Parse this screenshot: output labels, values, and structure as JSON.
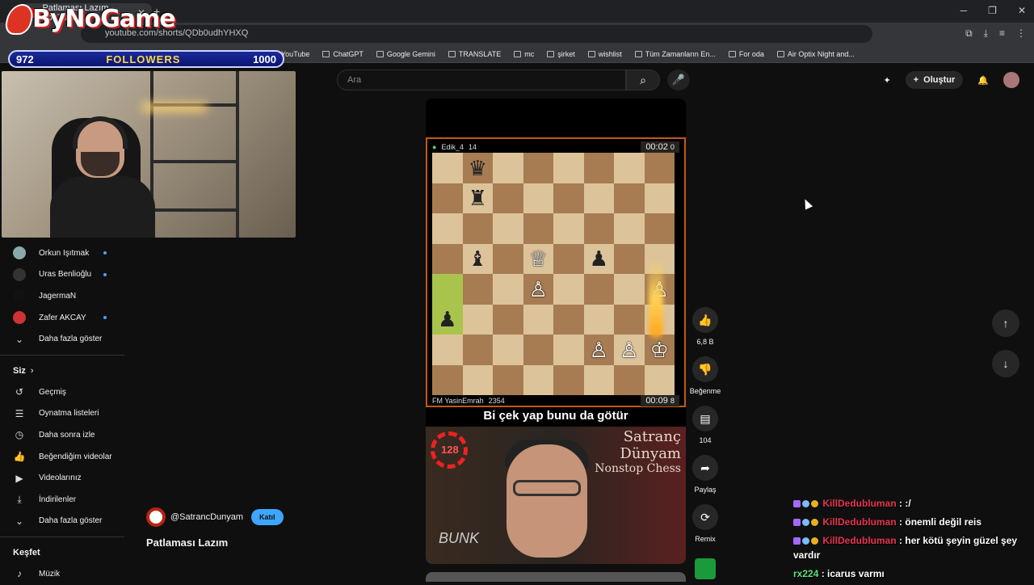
{
  "browser": {
    "tab_title": "Patlaması Lazım - YouTube",
    "url": "youtube.com/shorts/QDb0udhYHXQ",
    "bookmarks": [
      "YouTube",
      "ChatGPT",
      "Google Gemini",
      "TRANSLATE",
      "mc",
      "şirket",
      "wishlist",
      "Tüm Zamanların En...",
      "For oda",
      "Air Optix Night and..."
    ]
  },
  "overlay": {
    "logo_text": "ByNoGame",
    "followers_current": "972",
    "followers_label": "FOLLOWERS",
    "followers_goal": "1000"
  },
  "sidebar": {
    "subscriptions": [
      {
        "name": "Orkun Işıtmak",
        "live": true
      },
      {
        "name": "Uras Benlioğlu",
        "live": true
      },
      {
        "name": "JagermaN",
        "live": false
      },
      {
        "name": "Zafer AKCAY",
        "live": true
      }
    ],
    "show_more": "Daha fazla göster",
    "you_header": "Siz",
    "you_items": [
      "Geçmiş",
      "Oynatma listeleri",
      "Daha sonra izle",
      "Beğendiğim videolar",
      "Videolarınız",
      "İndirilenler",
      "Daha fazla göster"
    ],
    "explore_header": "Keşfet",
    "explore_items": [
      "Müzik"
    ]
  },
  "header": {
    "search_placeholder": "Ara",
    "create_label": "Oluştur"
  },
  "short": {
    "top_player": "Edik_4",
    "top_rating": "14",
    "top_clock": "00:02",
    "top_clock_tenths": "0",
    "bottom_player": "FM YasinEmrah",
    "bottom_rating": "2354",
    "bottom_clock": "00:09",
    "bottom_clock_tenths": "8",
    "caption": "Bi çek yap bunu da götür",
    "brand_line1": "Satranç",
    "brand_line2": "Dünyam",
    "brand_line3": "Nonstop Chess",
    "overlay_timer": "128",
    "watermark": "BUNK"
  },
  "actions": {
    "like_count": "6,8 B",
    "dislike_label": "Beğenme",
    "comment_count": "104",
    "share_label": "Paylaş",
    "remix_label": "Remix"
  },
  "channel": {
    "handle": "@SatrancDunyam",
    "join_label": "Katıl",
    "video_title": "Patlaması Lazım"
  },
  "chat": [
    {
      "user": "KillDedubluman",
      "text": ": :/"
    },
    {
      "user": "KillDedubluman",
      "text": ": önemli değil reis"
    },
    {
      "user": "KillDedubluman",
      "text": ": her kötü şeyin güzel şey vardır"
    },
    {
      "user": "rx224",
      "text": ": icarus varmı"
    }
  ],
  "board": [
    [
      "",
      "bQ",
      "",
      "",
      "",
      "",
      "",
      ""
    ],
    [
      "",
      "bR",
      "",
      "",
      "",
      "",
      "",
      ""
    ],
    [
      "",
      "",
      "",
      "",
      "",
      "",
      "",
      ""
    ],
    [
      "",
      "bB",
      "",
      "wQ",
      "",
      "bP",
      "",
      ""
    ],
    [
      "",
      "",
      "",
      "wP",
      "",
      "",
      "",
      "wP"
    ],
    [
      "bP",
      "",
      "",
      "",
      "",
      "",
      "",
      ""
    ],
    [
      "",
      "",
      "",
      "",
      "",
      "wP",
      "wP",
      "wK"
    ],
    [
      "",
      "",
      "",
      "",
      "",
      "",
      "",
      ""
    ]
  ]
}
